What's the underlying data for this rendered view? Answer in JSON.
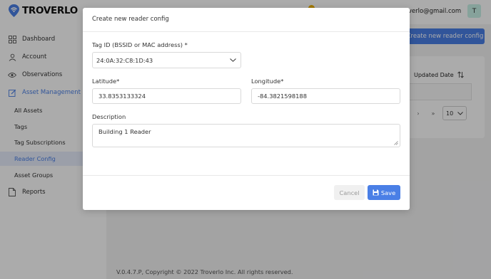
{
  "app": {
    "brand": "TROVERLO",
    "user_email": "troverlo@gmail.com",
    "user_initial": "T"
  },
  "sidebar": {
    "items": [
      {
        "label": "Dashboard",
        "icon": "grid-icon"
      },
      {
        "label": "Account",
        "icon": "user-icon"
      },
      {
        "label": "Observations",
        "icon": "eye-icon"
      },
      {
        "label": "Asset Management",
        "icon": "edit-icon"
      }
    ],
    "sub_items": [
      {
        "label": "All Assets"
      },
      {
        "label": "Tags"
      },
      {
        "label": "Tag Subscriptions"
      },
      {
        "label": "Reader Config"
      },
      {
        "label": "Asset Groups"
      }
    ],
    "reports": {
      "label": "Reports",
      "icon": "document-icon"
    }
  },
  "page": {
    "new_config_button": "Create new reader config",
    "table_header": "Updated Date",
    "page_size": "10",
    "footer": "V.0.4.7.P,   Copyright © 2022 Troverlo Inc. All rights reserved."
  },
  "modal": {
    "title": "Create new reader config",
    "tag_id_label": "Tag ID (BSSID or MAC address) *",
    "tag_id_value": "24:0A:32:C8:1D:43",
    "latitude_label": "Latitude*",
    "latitude_value": "33.8353133324",
    "longitude_label": "Longitude*",
    "longitude_value": "-84.3821598188",
    "description_label": "Description",
    "description_value": "Building 1 Reader",
    "cancel_label": "Cancel",
    "save_label": "Save"
  },
  "colors": {
    "accent": "#4a7fe6",
    "avatar_bg": "#c8f2e8",
    "notification": "#f0b400"
  }
}
